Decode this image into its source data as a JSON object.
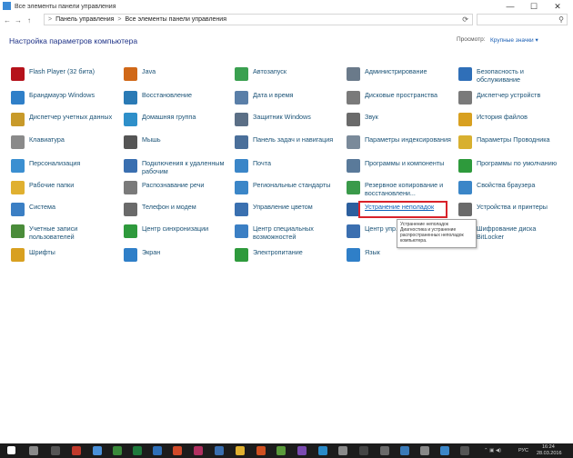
{
  "window": {
    "title": "Все элементы панели управления",
    "minimize_glyph": "—",
    "maximize_glyph": "☐",
    "close_glyph": "✕"
  },
  "address": {
    "breadcrumb": [
      "Панель управления",
      "Все элементы панели управления"
    ],
    "separator": ">",
    "search_placeholder": ""
  },
  "header": {
    "heading": "Настройка параметров компьютера",
    "view_by_label": "Просмотр:",
    "view_by_value": "Крупные значки ▾"
  },
  "items": [
    {
      "label": "Flash Player (32 бита)",
      "color": "#b5121b",
      "icon": "flash-icon"
    },
    {
      "label": "Брандмауэр Windows",
      "color": "#2f7fc8",
      "icon": "firewall-icon"
    },
    {
      "label": "Диспетчер учетных данных",
      "color": "#c89a2a",
      "icon": "credential-icon"
    },
    {
      "label": "Клавиатура",
      "color": "#8a8a8a",
      "icon": "keyboard-icon"
    },
    {
      "label": "Персонализация",
      "color": "#3b8fd1",
      "icon": "personalization-icon"
    },
    {
      "label": "Рабочие папки",
      "color": "#e0b030",
      "icon": "work-folders-icon"
    },
    {
      "label": "Система",
      "color": "#3b7fc4",
      "icon": "system-icon"
    },
    {
      "label": "Учетные записи пользователей",
      "color": "#4a8c3a",
      "icon": "user-accounts-icon"
    },
    {
      "label": "Шрифты",
      "color": "#d8a020",
      "icon": "fonts-icon"
    },
    {
      "label": "Java",
      "color": "#d06818",
      "icon": "java-icon"
    },
    {
      "label": "Восстановление",
      "color": "#2a7ab5",
      "icon": "recovery-icon"
    },
    {
      "label": "Домашняя группа",
      "color": "#2e8fc9",
      "icon": "homegroup-icon"
    },
    {
      "label": "Мышь",
      "color": "#555555",
      "icon": "mouse-icon"
    },
    {
      "label": "Подключения к удаленным рабочим",
      "color": "#3a6fb0",
      "icon": "remote-desktop-icon"
    },
    {
      "label": "Распознавание речи",
      "color": "#7a7a7a",
      "icon": "speech-icon"
    },
    {
      "label": "Телефон и модем",
      "color": "#6a6a6a",
      "icon": "phone-modem-icon"
    },
    {
      "label": "Центр синхронизации",
      "color": "#2e9a3c",
      "icon": "sync-center-icon"
    },
    {
      "label": "Экран",
      "color": "#2f7fc8",
      "icon": "display-icon"
    },
    {
      "label": "Автозапуск",
      "color": "#3aa050",
      "icon": "autoplay-icon"
    },
    {
      "label": "Дата и время",
      "color": "#5a7fa8",
      "icon": "date-time-icon"
    },
    {
      "label": "Защитник Windows",
      "color": "#5b6f86",
      "icon": "defender-icon"
    },
    {
      "label": "Панель задач и навигация",
      "color": "#4a6f9a",
      "icon": "taskbar-icon"
    },
    {
      "label": "Почта",
      "color": "#3b86c8",
      "icon": "mail-icon"
    },
    {
      "label": "Региональные стандарты",
      "color": "#3b86c8",
      "icon": "region-icon"
    },
    {
      "label": "Управление цветом",
      "color": "#3a70b0",
      "icon": "color-management-icon"
    },
    {
      "label": "Центр специальных возможностей",
      "color": "#3b7fc4",
      "icon": "ease-of-access-icon"
    },
    {
      "label": "Электропитание",
      "color": "#2e9a3c",
      "icon": "power-icon"
    },
    {
      "label": "Администрирование",
      "color": "#6a7a8a",
      "icon": "admin-tools-icon"
    },
    {
      "label": "Дисковые пространства",
      "color": "#7a7a7a",
      "icon": "storage-spaces-icon"
    },
    {
      "label": "Звук",
      "color": "#6a6a6a",
      "icon": "sound-icon"
    },
    {
      "label": "Параметры индексирования",
      "color": "#7a8a9a",
      "icon": "indexing-icon"
    },
    {
      "label": "Программы и компоненты",
      "color": "#5a7a9a",
      "icon": "programs-icon"
    },
    {
      "label": "Резервное копирование и восстановлени...",
      "color": "#3a9a4a",
      "icon": "backup-icon"
    },
    {
      "label": "Устранение неполадок",
      "color": "#2c5f9e",
      "icon": "troubleshooting-icon"
    },
    {
      "label": "Центр упр... и общий д...",
      "color": "#3b6fb0",
      "icon": "network-center-icon"
    },
    {
      "label": "Язык",
      "color": "#2f7fc8",
      "icon": "language-icon"
    },
    {
      "label": "Безопасность и обслуживание",
      "color": "#2f6fb8",
      "icon": "security-maintenance-icon"
    },
    {
      "label": "Диспетчер устройств",
      "color": "#7a7a7a",
      "icon": "device-manager-icon"
    },
    {
      "label": "История файлов",
      "color": "#d8a020",
      "icon": "file-history-icon"
    },
    {
      "label": "Параметры Проводника",
      "color": "#d8b030",
      "icon": "explorer-options-icon"
    },
    {
      "label": "Программы по умолчанию",
      "color": "#2e9a3c",
      "icon": "default-programs-icon"
    },
    {
      "label": "Свойства браузера",
      "color": "#3b86c8",
      "icon": "browser-properties-icon"
    },
    {
      "label": "Устройства и принтеры",
      "color": "#6a6a6a",
      "icon": "devices-printers-icon"
    },
    {
      "label": "Шифрование диска BitLocker",
      "color": "#8a8a8a",
      "icon": "bitlocker-icon"
    }
  ],
  "tooltip": {
    "line1": "Устранение неполадок",
    "line2": "Диагностика и устранение распространенных неполадок компьютера."
  },
  "taskbar": {
    "time": "16:24",
    "date": "28.03.2016",
    "lang": "РУС"
  }
}
